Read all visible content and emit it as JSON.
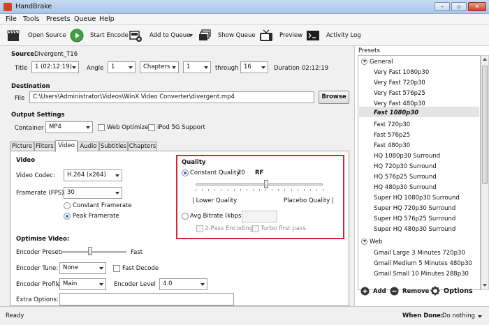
{
  "window": {
    "title": "HandBrake"
  },
  "menu": [
    "File",
    "Tools",
    "Presets",
    "Queue",
    "Help"
  ],
  "toolbar": {
    "open_source": "Open Source",
    "start_encode": "Start Encode",
    "add_to_queue": "Add to Queue",
    "show_queue": "Show Queue",
    "preview": "Preview",
    "activity_log": "Activity Log"
  },
  "source": {
    "label": "Source",
    "value": "Divergent_T16",
    "title_label": "Title",
    "title_value": "1 (02:12:19)",
    "angle_label": "Angle",
    "angle_value": "1",
    "range_type": "Chapters",
    "range_start": "1",
    "through_label": "through",
    "range_end": "16",
    "duration_label": "Duration",
    "duration_value": "02:12:19"
  },
  "destination": {
    "label": "Destination",
    "file_label": "File",
    "file_value": "C:\\Users\\Administrator\\Videos\\WinX Video Converter\\divergent.mp4",
    "browse": "Browse"
  },
  "output": {
    "label": "Output Settings",
    "container_label": "Container",
    "container_value": "MP4",
    "web_optimized": "Web Optimized",
    "ipod_5g": "iPod 5G Support"
  },
  "tabs": [
    "Picture",
    "Filters",
    "Video",
    "Audio",
    "Subtitles",
    "Chapters"
  ],
  "video": {
    "heading": "Video",
    "codec_label": "Video Codec:",
    "codec_value": "H.264 (x264)",
    "framerate_label": "Framerate (FPS):",
    "framerate_value": "30",
    "constant_framerate": "Constant Framerate",
    "peak_framerate": "Peak Framerate"
  },
  "quality": {
    "heading": "Quality",
    "constant_label": "Constant Quality:",
    "constant_value": "20",
    "unit": "RF",
    "lower": "| Lower Quality",
    "placebo": "Placebo Quality |",
    "avg_bitrate": "Avg Bitrate (kbps):",
    "two_pass": "2-Pass Encoding",
    "turbo": "Turbo first pass",
    "slider_level": 0.555
  },
  "optimise": {
    "heading": "Optimise Video:",
    "preset_label": "Encoder Preset:",
    "preset_fast": "Fast",
    "preset_level": 0.45,
    "tune_label": "Encoder Tune:",
    "tune_value": "None",
    "fast_decode": "Fast Decode",
    "profile_label": "Encoder Profile:",
    "profile_value": "Main",
    "level_label": "Encoder Level",
    "level_value": "4.0",
    "extra_label": "Extra Options:"
  },
  "presets": {
    "title": "Presets",
    "general": "General",
    "items": [
      "Very Fast 1080p30",
      "Very Fast 720p30",
      "Very Fast 576p25",
      "Very Fast 480p30",
      "Fast 1080p30",
      "Fast 720p30",
      "Fast 576p25",
      "Fast 480p30",
      "HQ 1080p30 Surround",
      "HQ 720p30 Surround",
      "HQ 576p25 Surround",
      "HQ 480p30 Surround",
      "Super HQ 1080p30 Surround",
      "Super HQ 720p30 Surround",
      "Super HQ 576p25 Surround",
      "Super HQ 480p30 Surround"
    ],
    "selected": "Fast 1080p30",
    "web": "Web",
    "web_items": [
      "Gmail Large 3 Minutes 720p30",
      "Gmail Medium 5 Minutes 480p30",
      "Gmail Small 10 Minutes 288p30"
    ],
    "add": "Add",
    "remove": "Remove",
    "options": "Options"
  },
  "status": {
    "text": "Ready",
    "when_done_label": "When Done:",
    "when_done_value": "Do nothing"
  }
}
